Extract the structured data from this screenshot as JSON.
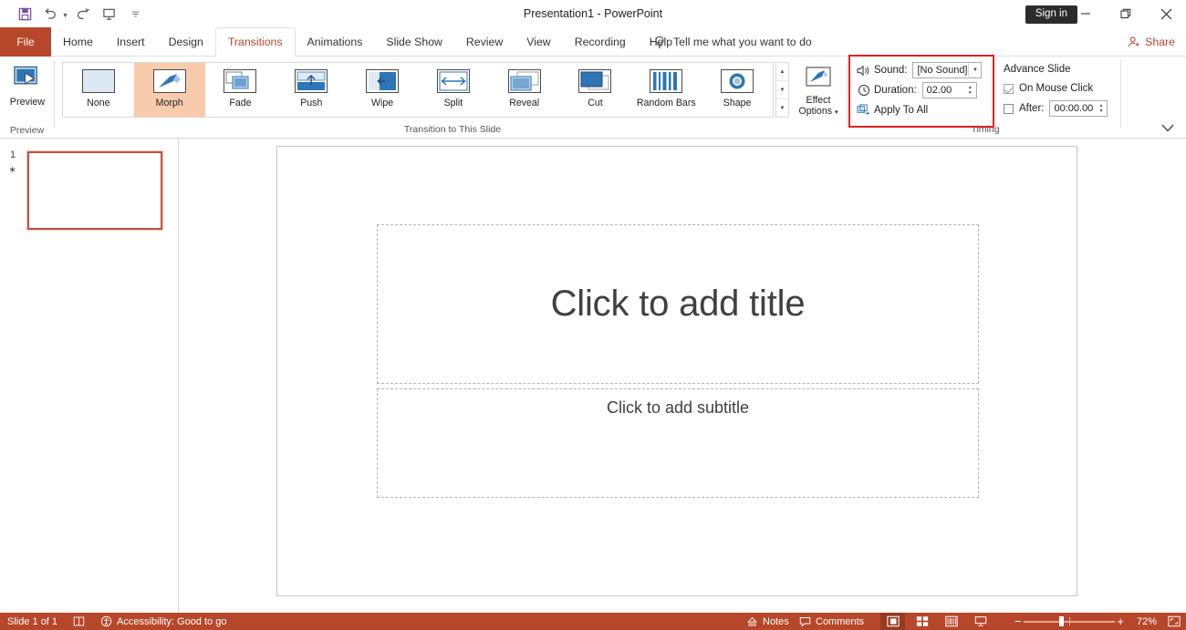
{
  "window": {
    "title": "Presentation1  -  PowerPoint",
    "signin_label": "Sign in",
    "minimize_icon": "minimize-icon",
    "restore_icon": "restore-icon",
    "close_icon": "close-icon"
  },
  "quick_access": [
    {
      "name": "save-icon",
      "label": "Save"
    },
    {
      "name": "undo-icon",
      "label": "Undo"
    },
    {
      "name": "redo-icon",
      "label": "Redo"
    },
    {
      "name": "start-slideshow-icon",
      "label": "Start From Beginning"
    },
    {
      "name": "customize-qat-icon",
      "label": "Customize Quick Access Toolbar"
    }
  ],
  "tabs": {
    "file": "File",
    "items": [
      {
        "label": "Home",
        "active": false
      },
      {
        "label": "Insert",
        "active": false
      },
      {
        "label": "Design",
        "active": false
      },
      {
        "label": "Transitions",
        "active": true
      },
      {
        "label": "Animations",
        "active": false
      },
      {
        "label": "Slide Show",
        "active": false
      },
      {
        "label": "Review",
        "active": false
      },
      {
        "label": "View",
        "active": false
      },
      {
        "label": "Recording",
        "active": false
      },
      {
        "label": "Help",
        "active": false
      }
    ],
    "tell_me": "Tell me what you want to do",
    "share": "Share"
  },
  "ribbon": {
    "groups": {
      "preview": "Preview",
      "transition_to_this_slide": "Transition to This Slide",
      "timing": "Timing"
    },
    "preview_button": "Preview",
    "gallery": [
      {
        "label": "None",
        "icon": "transition-none-icon",
        "selected": false
      },
      {
        "label": "Morph",
        "icon": "transition-morph-icon",
        "selected": true
      },
      {
        "label": "Fade",
        "icon": "transition-fade-icon",
        "selected": false
      },
      {
        "label": "Push",
        "icon": "transition-push-icon",
        "selected": false
      },
      {
        "label": "Wipe",
        "icon": "transition-wipe-icon",
        "selected": false
      },
      {
        "label": "Split",
        "icon": "transition-split-icon",
        "selected": false
      },
      {
        "label": "Reveal",
        "icon": "transition-reveal-icon",
        "selected": false
      },
      {
        "label": "Cut",
        "icon": "transition-cut-icon",
        "selected": false
      },
      {
        "label": "Random Bars",
        "icon": "transition-random-bars-icon",
        "selected": false
      },
      {
        "label": "Shape",
        "icon": "transition-shape-icon",
        "selected": false
      }
    ],
    "gallery_scroll": {
      "up": "scroll-up-icon",
      "down": "scroll-down-icon",
      "more": "more-transitions-icon"
    },
    "effect_options": {
      "line1": "Effect",
      "line2": "Options"
    },
    "timing": {
      "sound_label": "Sound:",
      "sound_value": "[No Sound]",
      "duration_label": "Duration:",
      "duration_value": "02.00",
      "apply_to_all": "Apply To All"
    },
    "advance_slide": {
      "heading": "Advance Slide",
      "on_mouse_click_label": "On Mouse Click",
      "on_mouse_click_checked": true,
      "after_label": "After:",
      "after_checked": false,
      "after_value": "00:00.00"
    },
    "collapse_icon": "chevron-down-icon",
    "highlight_color": "#e02020",
    "accent_color": "#b7472a",
    "selected_fill": "#f8cbad"
  },
  "slides_pane": {
    "slide_number": "1",
    "transition_marker": "transition-star-icon"
  },
  "slide": {
    "title_placeholder": "Click to add title",
    "subtitle_placeholder": "Click to add subtitle"
  },
  "status_bar": {
    "slide_count": "Slide 1 of 1",
    "language_icon": "spell-check-icon",
    "accessibility": "Accessibility: Good to go",
    "notes": "Notes",
    "comments": "Comments",
    "views": [
      {
        "name": "normal-view-button",
        "active": true
      },
      {
        "name": "slide-sorter-view-button",
        "active": false
      },
      {
        "name": "reading-view-button",
        "active": false
      },
      {
        "name": "slide-show-view-button",
        "active": false
      }
    ],
    "zoom_out": "−",
    "zoom_in": "+",
    "zoom_level": "72%",
    "fit_slide_icon": "fit-to-window-icon"
  }
}
